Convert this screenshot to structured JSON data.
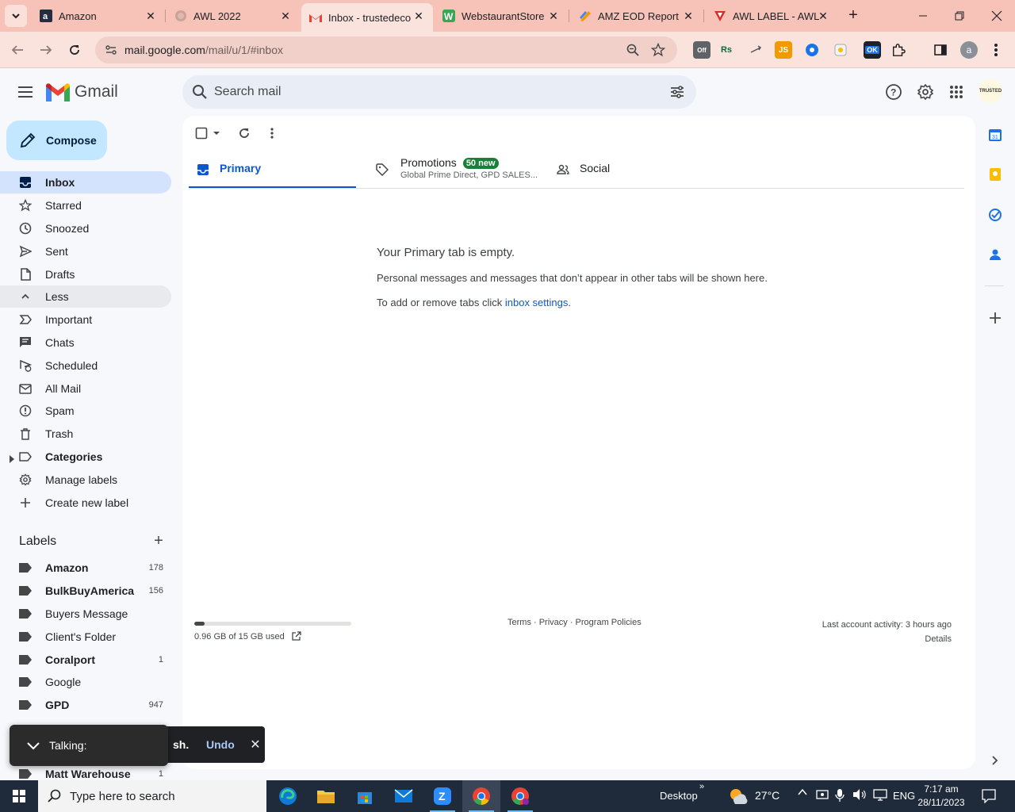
{
  "browser": {
    "tabs": [
      {
        "title": "Amazon",
        "icon": "amazon-icon",
        "active": false
      },
      {
        "title": "AWL 2022",
        "icon": "globe-icon",
        "active": false
      },
      {
        "title": "Inbox - trustedeco",
        "icon": "gmail-icon",
        "active": true
      },
      {
        "title": "WebstaurantStore",
        "icon": "webstaurant-icon",
        "active": false
      },
      {
        "title": "AMZ EOD Report",
        "icon": "report-icon",
        "active": false
      },
      {
        "title": "AWL LABEL - AWL",
        "icon": "awl-icon",
        "active": false
      }
    ],
    "url_host": "mail.google.com",
    "url_path": "/mail/u/1/#inbox",
    "profile_initial": "a",
    "extensions": [
      "Off",
      "Rs",
      "JS",
      "OK"
    ]
  },
  "gmail": {
    "app_name": "Gmail",
    "search_placeholder": "Search mail",
    "compose_label": "Compose",
    "org_logo_text": "TRUSTED",
    "nav": [
      {
        "label": "Inbox",
        "icon": "inbox-icon",
        "count": ""
      },
      {
        "label": "Starred",
        "icon": "star-icon",
        "count": ""
      },
      {
        "label": "Snoozed",
        "icon": "clock-icon",
        "count": ""
      },
      {
        "label": "Sent",
        "icon": "send-icon",
        "count": ""
      },
      {
        "label": "Drafts",
        "icon": "draft-icon",
        "count": ""
      },
      {
        "label": "Less",
        "icon": "chevron-up-icon",
        "count": ""
      },
      {
        "label": "Important",
        "icon": "important-icon",
        "count": ""
      },
      {
        "label": "Chats",
        "icon": "chat-icon",
        "count": ""
      },
      {
        "label": "Scheduled",
        "icon": "scheduled-icon",
        "count": ""
      },
      {
        "label": "All Mail",
        "icon": "all-mail-icon",
        "count": ""
      },
      {
        "label": "Spam",
        "icon": "spam-icon",
        "count": ""
      },
      {
        "label": "Trash",
        "icon": "trash-icon",
        "count": ""
      },
      {
        "label": "Categories",
        "icon": "label-outline-icon",
        "count": ""
      },
      {
        "label": "Manage labels",
        "icon": "gear-icon",
        "count": ""
      },
      {
        "label": "Create new label",
        "icon": "plus-icon",
        "count": ""
      }
    ],
    "labels_title": "Labels",
    "labels": [
      {
        "label": "Amazon",
        "count": "178",
        "bold": true
      },
      {
        "label": "BulkBuyAmerica",
        "count": "156",
        "bold": true
      },
      {
        "label": "Buyers Message",
        "count": "",
        "bold": false
      },
      {
        "label": "Client's Folder",
        "count": "",
        "bold": false
      },
      {
        "label": "Coralport",
        "count": "1",
        "bold": true
      },
      {
        "label": "Google",
        "count": "",
        "bold": false
      },
      {
        "label": "GPD",
        "count": "947",
        "bold": true
      },
      {
        "label": "Matt Warehouse",
        "count": "1",
        "bold": true
      }
    ],
    "tabs": {
      "primary": "Primary",
      "promotions": "Promotions",
      "promotions_badge": "50 new",
      "promotions_sub": "Global Prime Direct, GPD SALES...",
      "social": "Social"
    },
    "empty": {
      "title": "Your Primary tab is empty.",
      "line1": "Personal messages and messages that don’t appear in other tabs will be shown here.",
      "line2_prefix": "To add or remove tabs click ",
      "line2_link": "inbox settings",
      "line2_suffix": "."
    },
    "footer": {
      "storage_text": "0.96 GB of 15 GB used",
      "storage_fraction": 0.064,
      "policies": "Terms · Privacy · Program Policies",
      "activity": "Last account activity: 3 hours ago",
      "details": "Details"
    },
    "snackbar": {
      "text": "sh.",
      "undo": "Undo"
    },
    "talking": "Talking:"
  },
  "taskbar": {
    "search_placeholder": "Type here to search",
    "desktop": "Desktop",
    "temperature": "27°C",
    "language": "ENG",
    "time": "7:17 am",
    "date": "28/11/2023"
  }
}
